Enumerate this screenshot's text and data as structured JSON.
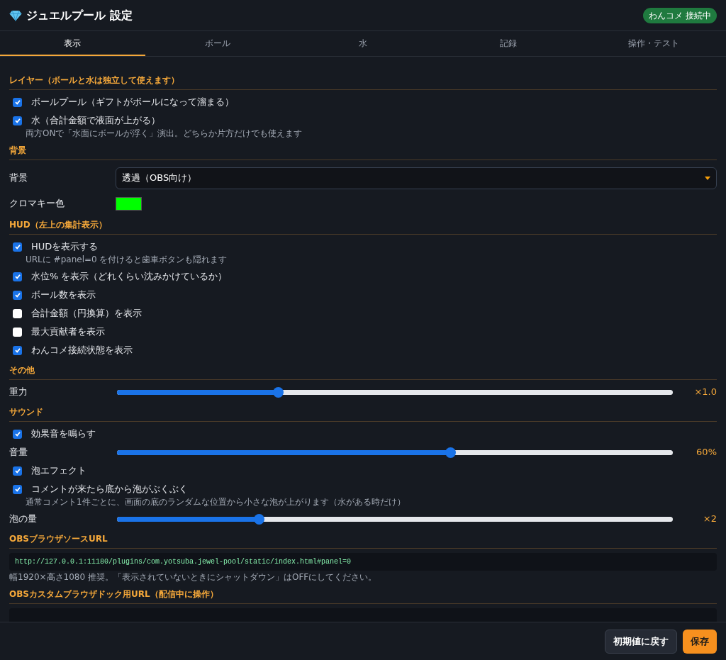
{
  "window": {
    "title": "ジュエルプール 設定",
    "status_badge": "わんコメ 接続中"
  },
  "tabs": [
    {
      "label": "表示",
      "selected": true
    },
    {
      "label": "ボール",
      "selected": false
    },
    {
      "label": "水",
      "selected": false
    },
    {
      "label": "記録",
      "selected": false
    },
    {
      "label": "操作・テスト",
      "selected": false
    }
  ],
  "sections": [
    {
      "title": "レイヤー（ボールと水は独立して使えます）",
      "items": [
        {
          "kind": "checkbox",
          "label": "ボールプール（ギフトがボールになって溜まる）",
          "checked": true
        },
        {
          "kind": "checkbox",
          "label": "水（合計金額で液面が上がる）",
          "checked": true
        },
        {
          "kind": "hint",
          "text": "両方ONで「水面にボールが浮く」演出。どちらか片方だけでも使えます"
        }
      ]
    },
    {
      "title": "背景",
      "items": [
        {
          "kind": "select",
          "label": "背景",
          "value": "透過（OBS向け）"
        },
        {
          "kind": "color",
          "label": "クロマキー色",
          "color": "#00ff00"
        }
      ]
    },
    {
      "title": "HUD（左上の集計表示）",
      "items": [
        {
          "kind": "checkbox",
          "label": "HUDを表示する",
          "checked": true
        },
        {
          "kind": "hint",
          "text": "URLに #panel=0 を付けると歯車ボタンも隠れます"
        },
        {
          "kind": "checkbox",
          "label": "水位% を表示（どれくらい沈みかけているか）",
          "checked": true
        },
        {
          "kind": "checkbox",
          "label": "ボール数を表示",
          "checked": true
        },
        {
          "kind": "checkbox",
          "label": "合計金額（円換算）を表示",
          "checked": false
        },
        {
          "kind": "checkbox",
          "label": "最大貢献者を表示",
          "checked": false
        },
        {
          "kind": "checkbox",
          "label": "わんコメ接続状態を表示",
          "checked": true
        }
      ]
    },
    {
      "title": "その他",
      "items": [
        {
          "kind": "slider",
          "label": "重力",
          "level": 0.29,
          "reading": "×1.0"
        }
      ]
    },
    {
      "title": "サウンド",
      "items": [
        {
          "kind": "checkbox",
          "label": "効果音を鳴らす",
          "checked": true
        },
        {
          "kind": "slider",
          "label": "音量",
          "level": 0.6,
          "reading": "60%"
        },
        {
          "kind": "checkbox",
          "label": "泡エフェクト",
          "checked": true
        },
        {
          "kind": "checkbox",
          "label": "コメントが来たら底から泡がぶくぶく",
          "checked": true
        },
        {
          "kind": "hint",
          "text": "通常コメント1件ごとに、画面の底のランダムな位置から小さな泡が上がります（水がある時だけ）"
        },
        {
          "kind": "slider",
          "label": "泡の量",
          "level": 0.255,
          "reading": "×2"
        }
      ]
    },
    {
      "title": "OBSブラウザソースURL",
      "items": [
        {
          "kind": "code",
          "text": "http://127.0.0.1:11180/plugins/com.yotsuba.jewel-pool/static/index.html#panel=0"
        },
        {
          "kind": "note",
          "text": "幅1920×高さ1080 推奨。「表示されていないときにシャットダウン」はOFFにしてください。"
        }
      ]
    },
    {
      "title": "OBSカスタムブラウザドック用URL（配信中に操作）",
      "items": [
        {
          "kind": "code"
        }
      ]
    }
  ],
  "footer": {
    "buttons": [
      {
        "label": "初期値に戻す",
        "kind": "secondary"
      },
      {
        "label": "保存",
        "kind": "primary"
      }
    ]
  }
}
